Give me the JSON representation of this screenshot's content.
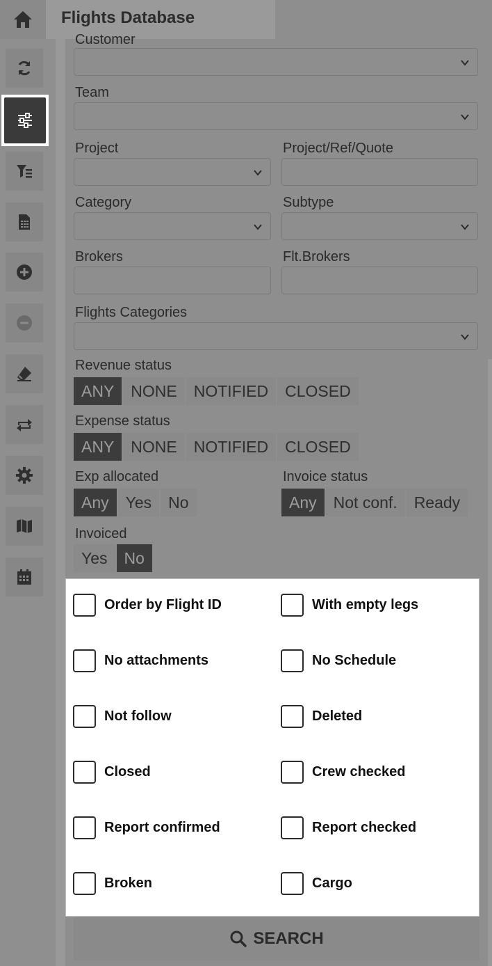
{
  "header": {
    "title": "Flights Database"
  },
  "sidebar": {
    "items": [
      {
        "name": "refresh-icon"
      },
      {
        "name": "sliders-icon",
        "active": true
      },
      {
        "name": "filter-list-icon"
      },
      {
        "name": "spreadsheet-icon"
      },
      {
        "name": "add-circle-icon"
      },
      {
        "name": "remove-circle-icon"
      },
      {
        "name": "eraser-icon"
      },
      {
        "name": "swap-icon"
      },
      {
        "name": "gear-icon"
      },
      {
        "name": "map-icon"
      },
      {
        "name": "calendar-icon"
      }
    ]
  },
  "filters": {
    "customer_label": "Customer",
    "team_label": "Team",
    "project_label": "Project",
    "project_ref_label": "Project/Ref/Quote",
    "category_label": "Category",
    "subtype_label": "Subtype",
    "brokers_label": "Brokers",
    "flt_brokers_label": "Flt.Brokers",
    "flights_categories_label": "Flights Categories",
    "revenue_status": {
      "label": "Revenue status",
      "options": [
        "ANY",
        "NONE",
        "NOTIFIED",
        "CLOSED"
      ],
      "selected": "ANY"
    },
    "expense_status": {
      "label": "Expense status",
      "options": [
        "ANY",
        "NONE",
        "NOTIFIED",
        "CLOSED"
      ],
      "selected": "ANY"
    },
    "exp_allocated": {
      "label": "Exp allocated",
      "options": [
        "Any",
        "Yes",
        "No"
      ],
      "selected": "Any"
    },
    "invoice_status": {
      "label": "Invoice status",
      "options": [
        "Any",
        "Not conf.",
        "Ready"
      ],
      "selected": "Any"
    },
    "invoiced": {
      "label": "Invoiced",
      "options": [
        "Yes",
        "No"
      ],
      "selected": "No"
    }
  },
  "checkboxes": [
    {
      "label": "Order by Flight ID",
      "checked": false
    },
    {
      "label": "With empty legs",
      "checked": false
    },
    {
      "label": "No attachments",
      "checked": false
    },
    {
      "label": "No Schedule",
      "checked": false
    },
    {
      "label": "Not follow",
      "checked": false
    },
    {
      "label": "Deleted",
      "checked": false
    },
    {
      "label": "Closed",
      "checked": false
    },
    {
      "label": "Crew checked",
      "checked": false
    },
    {
      "label": "Report confirmed",
      "checked": false
    },
    {
      "label": "Report checked",
      "checked": false
    },
    {
      "label": "Broken",
      "checked": false
    },
    {
      "label": "Cargo",
      "checked": false
    }
  ],
  "search": {
    "label": "SEARCH"
  }
}
